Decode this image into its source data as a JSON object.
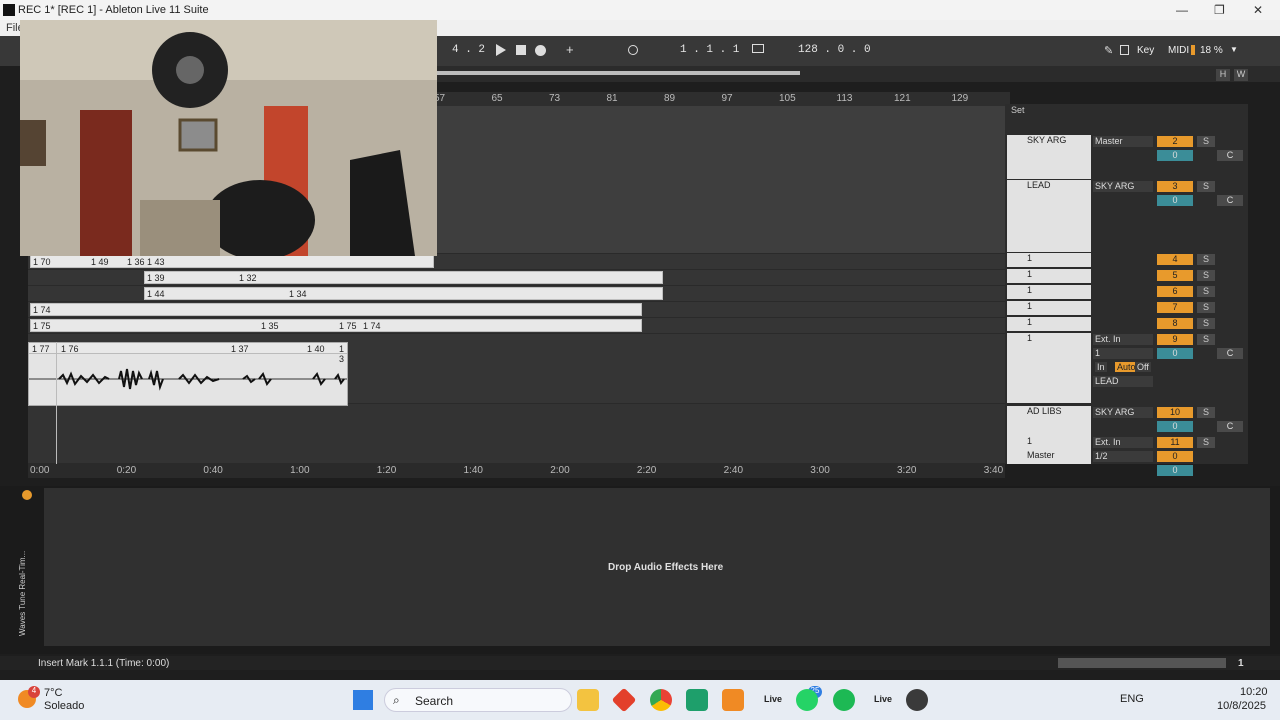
{
  "window": {
    "title": "REC 1*  [REC 1] - Ableton Live 11 Suite",
    "minimize": "—",
    "maximize": "❐",
    "close": "✕"
  },
  "menu": {
    "file": "File"
  },
  "toolbar": {
    "signature_fragment": "4 . 2",
    "position": "1 .  1 .  1",
    "tempo": "128 .  0 .  0",
    "key_label": "Key",
    "midi_label": "MIDI",
    "cpu": "18 %",
    "h_label": "H",
    "w_label": "W"
  },
  "ruler": {
    "bars": [
      "57",
      "65",
      "73",
      "81",
      "89",
      "97",
      "105",
      "113",
      "121",
      "129"
    ]
  },
  "set_label": "Set",
  "clips": {
    "lane1": [
      "1 70",
      "1 49",
      "1 36",
      "1 43"
    ],
    "lane2": [
      "1 39",
      "1 32"
    ],
    "lane3": [
      "1 44",
      "1 34"
    ],
    "lane4": [
      "1 74"
    ],
    "lane5": [
      "1 75",
      "1 35",
      "1 75",
      "1 74"
    ],
    "lane6": [
      "1 77",
      "1 76",
      "1 37",
      "1 40",
      "1 3"
    ]
  },
  "timeaxis": [
    "0:00",
    "0:20",
    "0:40",
    "1:00",
    "1:20",
    "1:40",
    "2:00",
    "2:20",
    "2:40",
    "3:00",
    "3:20",
    "3:40"
  ],
  "tracks": [
    {
      "name": "SKY ARG",
      "io": "Master",
      "num": "2",
      "s": "S",
      "pan": "0",
      "c": "C"
    },
    {
      "name": "LEAD",
      "io": "SKY ARG",
      "num": "3",
      "s": "S",
      "pan": "0",
      "c": "C"
    },
    {
      "name": "1",
      "num": "4",
      "s": "S"
    },
    {
      "name": "1",
      "num": "5",
      "s": "S"
    },
    {
      "name": "1",
      "num": "6",
      "s": "S"
    },
    {
      "name": "1",
      "num": "7",
      "s": "S"
    },
    {
      "name": "1",
      "num": "8",
      "s": "S"
    },
    {
      "name": "1",
      "io": "Ext. In",
      "io2": "1",
      "num": "9",
      "s": "S",
      "pan": "0",
      "c": "C",
      "monitor": [
        "In",
        "Auto",
        "Off"
      ],
      "out": "LEAD"
    },
    {
      "name": "AD LIBS",
      "io": "SKY ARG",
      "num": "10",
      "s": "S",
      "pan": "0",
      "c": "C"
    },
    {
      "name": "1",
      "io": "Ext. In",
      "num": "11",
      "s": "S"
    },
    {
      "name": "Master",
      "io": "1/2",
      "num": "0",
      "pan": "0"
    }
  ],
  "device": {
    "drop_text": "Drop Audio Effects Here",
    "side_label": "Waves Tune Real-Tim..."
  },
  "status": {
    "text": "Insert Mark 1.1.1 (Time: 0:00)",
    "right": "1"
  },
  "taskbar": {
    "weather_temp": "7°C",
    "weather_desc": "Soleado",
    "search": "Search",
    "lang": "ENG",
    "time": "10:20",
    "date": "10/8/2025",
    "badge": "25",
    "weather_badge": "4",
    "live_label": "Live"
  },
  "colors": {
    "accent_orange": "#e89a2c",
    "teal": "#3b8d98",
    "rec_red": "#d43a3a"
  }
}
